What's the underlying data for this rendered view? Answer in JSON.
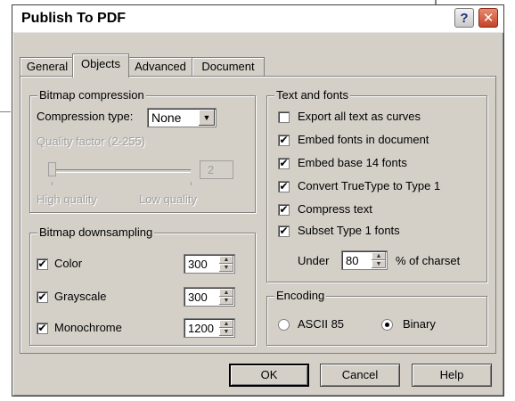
{
  "window": {
    "title": "Publish To PDF",
    "help_glyph": "?",
    "close_glyph": "✕"
  },
  "tabs": [
    {
      "label": "General",
      "active": false
    },
    {
      "label": "Objects",
      "active": true
    },
    {
      "label": "Advanced",
      "active": false
    },
    {
      "label": "Document",
      "active": false
    }
  ],
  "bitmap_compression": {
    "group_label": "Bitmap compression",
    "type_label": "Compression type:",
    "type_value": "None",
    "quality_label": "Quality factor (2-255)",
    "quality_value": "2",
    "high_label": "High quality",
    "low_label": "Low quality"
  },
  "bitmap_downsampling": {
    "group_label": "Bitmap downsampling",
    "rows": [
      {
        "label": "Color",
        "checked": true,
        "value": "300"
      },
      {
        "label": "Grayscale",
        "checked": true,
        "value": "300"
      },
      {
        "label": "Monochrome",
        "checked": true,
        "value": "1200"
      }
    ]
  },
  "text_fonts": {
    "group_label": "Text and fonts",
    "options": [
      {
        "label": "Export all text as curves",
        "checked": false
      },
      {
        "label": "Embed fonts in document",
        "checked": true
      },
      {
        "label": "Embed base 14 fonts",
        "checked": true
      },
      {
        "label": "Convert TrueType to Type 1",
        "checked": true
      },
      {
        "label": "Compress text",
        "checked": true
      },
      {
        "label": "Subset Type 1 fonts",
        "checked": true
      }
    ],
    "under_label": "Under",
    "under_value": "80",
    "charset_label": "% of charset"
  },
  "encoding": {
    "group_label": "Encoding",
    "options": [
      {
        "label": "ASCII 85",
        "selected": false
      },
      {
        "label": "Binary",
        "selected": true
      }
    ]
  },
  "buttons": {
    "ok": "OK",
    "cancel": "Cancel",
    "help": "Help"
  },
  "check_glyph": "✔",
  "icons": {
    "dropdown": "dropdown-arrow-icon",
    "spin_up": "spin-up-icon",
    "spin_down": "spin-down-icon"
  }
}
